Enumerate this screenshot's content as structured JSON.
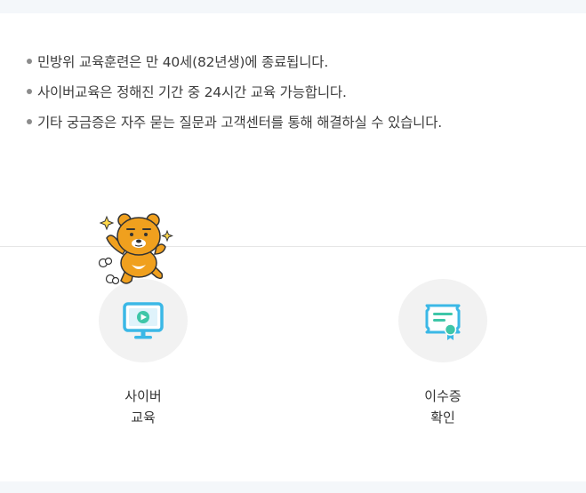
{
  "notices": [
    "민방위 교육훈련은 만 40세(82년생)에 종료됩니다.",
    "사이버교육은 정해진 기간 중 24시간 교육 가능합니다.",
    "기타 궁금증은 자주 묻는 질문과 고객센터를 통해 해결하실 수 있습니다."
  ],
  "menu": {
    "cyber": {
      "line1": "사이버",
      "line2": "교육",
      "icon": "monitor-play-icon"
    },
    "certificate": {
      "line1": "이수증",
      "line2": "확인",
      "icon": "certificate-icon"
    }
  },
  "colors": {
    "accent": "#3bb8e6",
    "cert_seal": "#3ec6a8",
    "mascot": "#f0a01e",
    "circle_bg": "#f2f2f2"
  }
}
